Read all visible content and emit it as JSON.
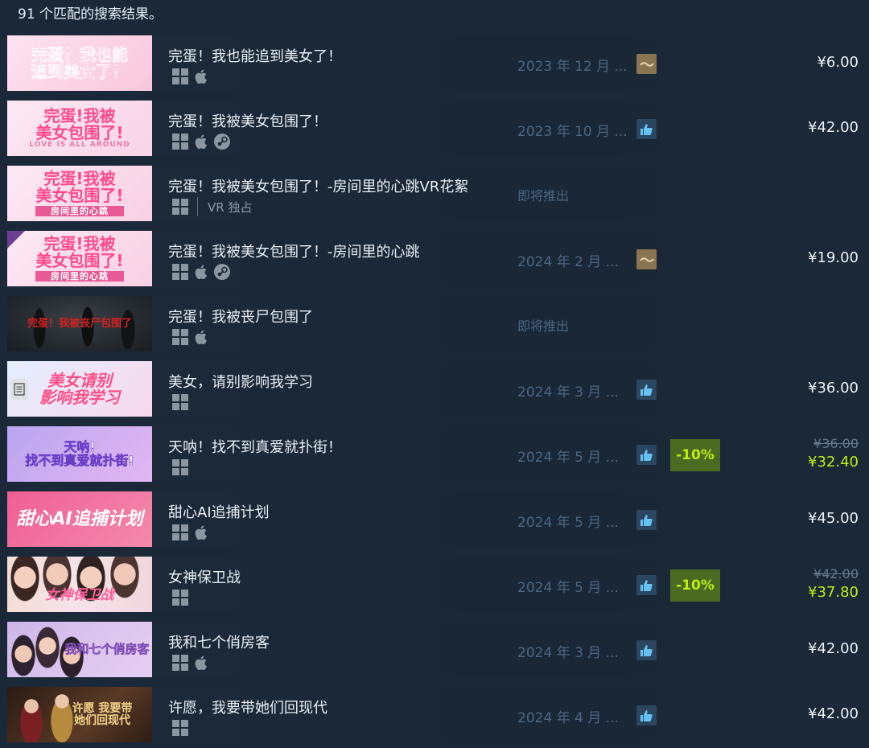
{
  "header": {
    "result_count_text": "91 个匹配的搜索结果。"
  },
  "colors": {
    "background": "#1b2838",
    "discount_bg": "#4c6b22",
    "discount_text": "#beee11",
    "date_text": "#4b6683",
    "review_positive": "#2b4760",
    "review_mixed": "#8a7552"
  },
  "results": [
    {
      "title": "完蛋！我也能追到美女了！",
      "thumb_text": "完蛋！我也能\n追到美女了！",
      "platforms": [
        "windows-icon",
        "apple-icon"
      ],
      "date": "2023 年 12 月 ...",
      "review": "mixed",
      "price": "¥6.00"
    },
    {
      "title": "完蛋！我被美女包围了！",
      "thumb_text": "完蛋!我被\n美女包围了!",
      "thumb_sub": "LOVE IS ALL AROUND",
      "platforms": [
        "windows-icon",
        "apple-icon",
        "steam-icon"
      ],
      "date": "2023 年 10 月 ...",
      "review": "positive",
      "price": "¥42.00"
    },
    {
      "title": "完蛋！我被美女包围了！-房间里的心跳VR花絮",
      "thumb_text": "完蛋!我被\n美女包围了!",
      "thumb_sub": "房间里的心跳",
      "platforms": [
        "windows-icon"
      ],
      "vr_text": "VR 独占",
      "coming_soon": "即将推出"
    },
    {
      "title": "完蛋！我被美女包围了！-房间里的心跳",
      "thumb_text": "完蛋!我被\n美女包围了!",
      "thumb_sub": "房间里的心跳",
      "platforms": [
        "windows-icon",
        "apple-icon",
        "steam-icon"
      ],
      "date": "2024 年 2 月 ...",
      "review": "mixed",
      "price": "¥19.00"
    },
    {
      "title": "完蛋！我被丧尸包围了",
      "thumb_text": "完蛋！我被丧尸包围了",
      "platforms": [
        "windows-icon",
        "apple-icon"
      ],
      "coming_soon": "即将推出"
    },
    {
      "title": "美女，请别影响我学习",
      "thumb_text": "美女请别\n影响我学习",
      "platforms": [
        "windows-icon"
      ],
      "date": "2024 年 3 月 ...",
      "review": "positive",
      "price": "¥36.00"
    },
    {
      "title": "天呐！找不到真爱就扑街！",
      "thumb_text": "天呐!\n找不到真爱就扑街!",
      "platforms": [
        "windows-icon"
      ],
      "date": "2024 年 5 月 ...",
      "review": "positive",
      "discount": "-10%",
      "price_old": "¥36.00",
      "price_new": "¥32.40"
    },
    {
      "title": "甜心AI追捕计划",
      "thumb_text": "甜心AI追捕计划",
      "platforms": [
        "windows-icon",
        "apple-icon"
      ],
      "date": "2024 年 5 月 ...",
      "review": "positive",
      "price": "¥45.00"
    },
    {
      "title": "女神保卫战",
      "thumb_text": "女神保卫战",
      "platforms": [
        "windows-icon"
      ],
      "date": "2024 年 5 月 ...",
      "review": "positive",
      "discount": "-10%",
      "price_old": "¥42.00",
      "price_new": "¥37.80"
    },
    {
      "title": "我和七个俏房客",
      "thumb_text": "我和七个俏房客",
      "platforms": [
        "windows-icon",
        "apple-icon"
      ],
      "date": "2024 年 3 月 ...",
      "review": "positive",
      "price": "¥42.00"
    },
    {
      "title": "许愿，我要带她们回现代",
      "thumb_text": "许愿 我要带\n她们回现代",
      "platforms": [
        "windows-icon"
      ],
      "date": "2024 年 4 月 ...",
      "review": "positive",
      "price": "¥42.00"
    }
  ]
}
